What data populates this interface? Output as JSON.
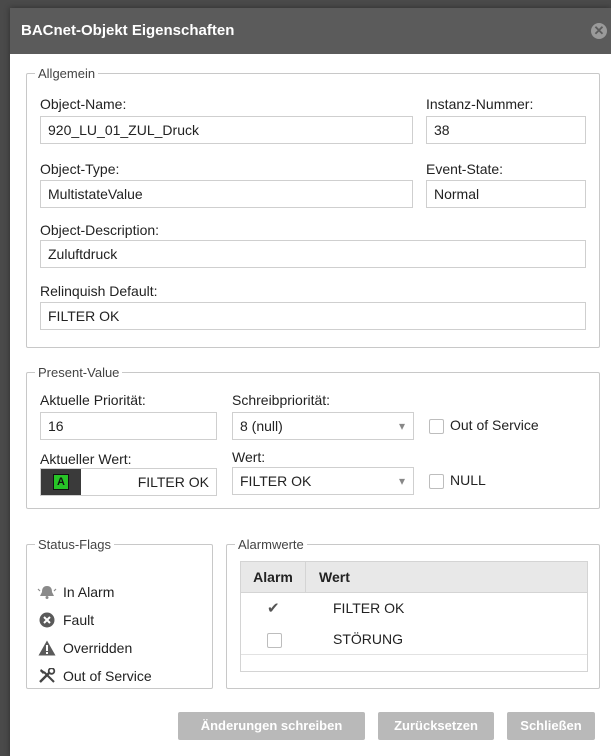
{
  "dialog": {
    "title": "BACnet-Objekt Eigenschaften"
  },
  "allgemein": {
    "legend": "Allgemein",
    "object_name_label": "Object-Name:",
    "object_name": "920_LU_01_ZUL_Druck",
    "instanz_label": "Instanz-Nummer:",
    "instanz": "38",
    "object_type_label": "Object-Type:",
    "object_type": "MultistateValue",
    "event_state_label": "Event-State:",
    "event_state": "Normal",
    "description_label": "Object-Description:",
    "description": "Zuluftdruck",
    "relinquish_label": "Relinquish Default:",
    "relinquish": "FILTER OK"
  },
  "present_value": {
    "legend": "Present-Value",
    "prio_label": "Aktuelle Priorität:",
    "prio": "16",
    "schreib_label": "Schreibpriorität:",
    "schreib": "8 (null)",
    "oos_label": "Out of Service",
    "wert_aktuell_label": "Aktueller Wert:",
    "wert_aktuell_badge": "A",
    "wert_aktuell": "FILTER OK",
    "wert_label": "Wert:",
    "wert": "FILTER OK",
    "null_label": "NULL"
  },
  "status_flags": {
    "legend": "Status-Flags",
    "items": [
      "In Alarm",
      "Fault",
      "Overridden",
      "Out of Service"
    ]
  },
  "alarmwerte": {
    "legend": "Alarmwerte",
    "col_alarm": "Alarm",
    "col_wert": "Wert",
    "rows": [
      {
        "checked": true,
        "wert": "FILTER OK"
      },
      {
        "checked": false,
        "wert": "STÖRUNG"
      }
    ]
  },
  "buttons": {
    "write": "Änderungen schreiben",
    "reset": "Zurücksetzen",
    "close": "Schließen"
  }
}
